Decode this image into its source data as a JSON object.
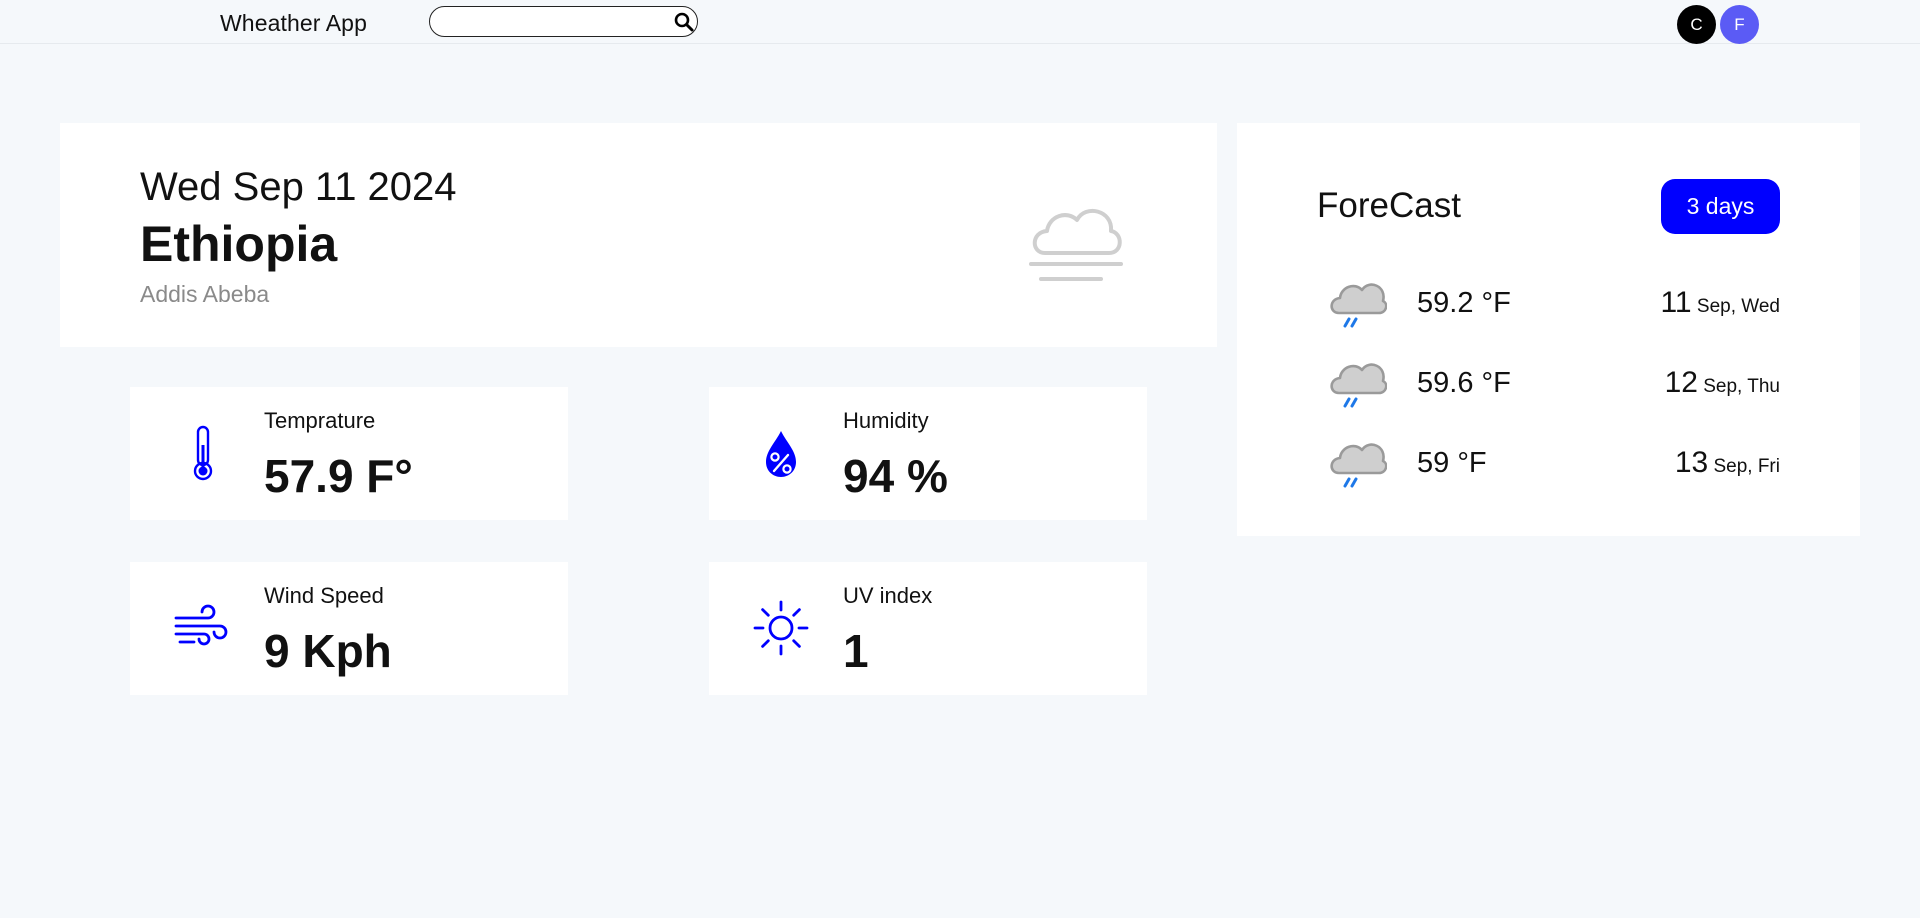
{
  "header": {
    "app_title": "Wheather App",
    "search": {
      "value": "",
      "placeholder": ""
    },
    "avatars": [
      {
        "letter": "C"
      },
      {
        "letter": "F"
      }
    ]
  },
  "location": {
    "date": "Wed Sep 11 2024",
    "country": "Ethiopia",
    "city": "Addis Abeba",
    "icon": "cloud-fog-icon"
  },
  "stats": [
    {
      "label": "Temprature",
      "value": "57.9 F°",
      "icon": "thermometer-icon"
    },
    {
      "label": "Humidity",
      "value": "94 %",
      "icon": "humidity-drop-icon"
    },
    {
      "label": "Wind Speed",
      "value": "9 Kph",
      "icon": "wind-icon"
    },
    {
      "label": "UV index",
      "value": "1",
      "icon": "sun-icon"
    }
  ],
  "forecast": {
    "title": "ForeCast",
    "range_button": "3 days",
    "days": [
      {
        "temp": "59.2 °F",
        "day": "11",
        "rest": " Sep, Wed",
        "icon": "rain-cloud-icon"
      },
      {
        "temp": "59.6 °F",
        "day": "12",
        "rest": " Sep, Thu",
        "icon": "rain-cloud-icon"
      },
      {
        "temp": "59 °F",
        "day": "13",
        "rest": " Sep, Fri",
        "icon": "rain-cloud-icon"
      }
    ]
  },
  "colors": {
    "accent": "#0000ff",
    "avatar_c": "#000000",
    "avatar_f": "#5b5bf5",
    "background": "#f5f8fb",
    "muted_text": "#8a8a8a"
  }
}
